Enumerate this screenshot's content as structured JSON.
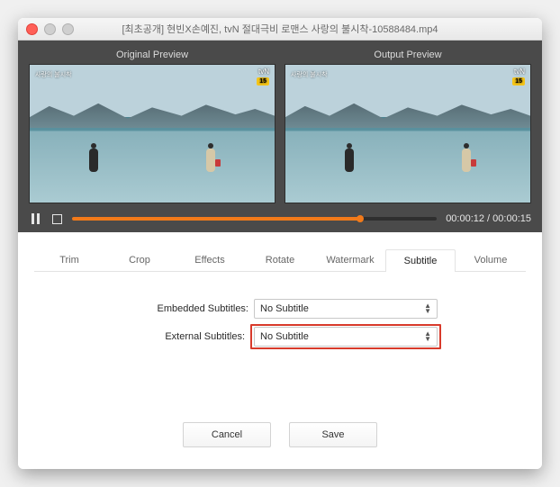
{
  "window": {
    "title": "[최초공개] 현빈X손예진, tvN 절대극비 로맨스 사랑의 불시착-10588484.mp4"
  },
  "preview": {
    "original_label": "Original Preview",
    "output_label": "Output  Preview",
    "channel_logo": "tvN",
    "age_rating": "15",
    "overlay_caption": "사랑의 불시착"
  },
  "player": {
    "current_time": "00:00:12",
    "total_time": "00:00:15",
    "time_display": "00:00:12 / 00:00:15"
  },
  "tabs": {
    "items": [
      {
        "label": "Trim"
      },
      {
        "label": "Crop"
      },
      {
        "label": "Effects"
      },
      {
        "label": "Rotate"
      },
      {
        "label": "Watermark"
      },
      {
        "label": "Subtitle"
      },
      {
        "label": "Volume"
      }
    ],
    "active_index": 5
  },
  "subtitle_pane": {
    "embedded_label": "Embedded Subtitles:",
    "embedded_value": "No Subtitle",
    "external_label": "External Subtitles:",
    "external_value": "No Subtitle"
  },
  "buttons": {
    "cancel": "Cancel",
    "save": "Save"
  }
}
